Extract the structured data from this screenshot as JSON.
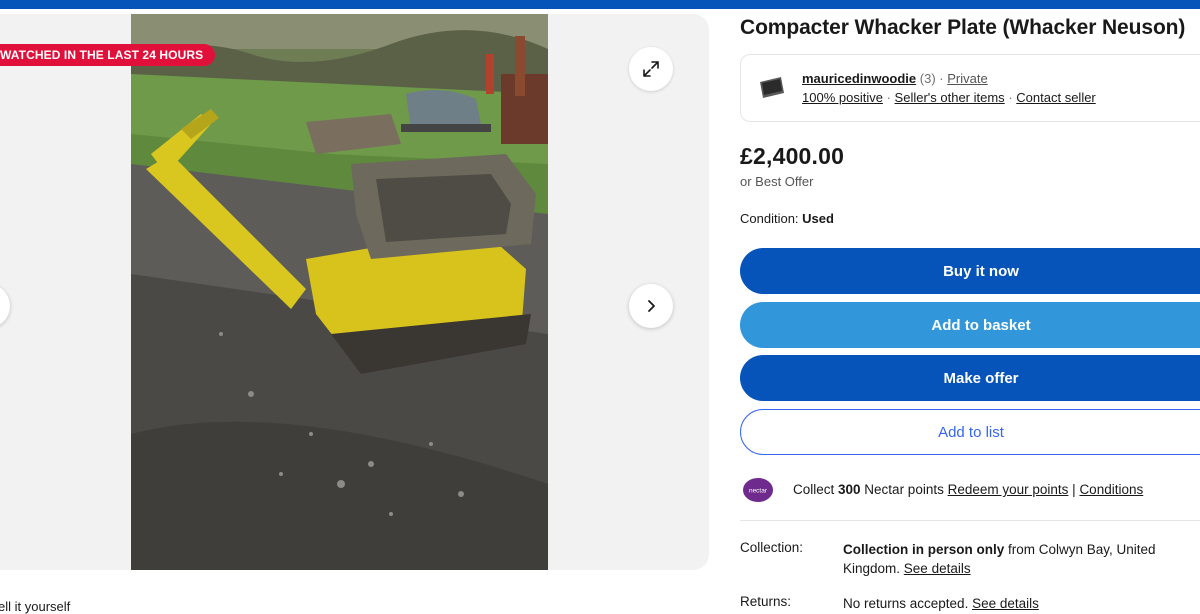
{
  "badge": {
    "watch_text": "WATCHED IN THE LAST 24 HOURS"
  },
  "bottom": {
    "text": "ell it yourself"
  },
  "listing": {
    "title": "Compacter Whacker Plate (Whacker Neuson)"
  },
  "seller": {
    "name": "mauricedinwoodie",
    "feedback_count": "(3)",
    "sep1": "·",
    "type": "Private",
    "positive": "100% positive",
    "sep2": "·",
    "other_items": "Seller's other items",
    "sep3": "·",
    "contact": "Contact seller"
  },
  "price": {
    "amount": "£2,400.00",
    "best_offer": "or Best Offer"
  },
  "condition": {
    "label": "Condition:",
    "value": "Used"
  },
  "buttons": {
    "buy_now": "Buy it now",
    "add_basket": "Add to basket",
    "make_offer": "Make offer",
    "add_list": "Add to list"
  },
  "nectar": {
    "logo": "nectar",
    "prefix": "Collect ",
    "points": "300",
    "suffix": " Nectar points ",
    "redeem": "Redeem your points",
    "pipe": " | ",
    "conditions": "Conditions"
  },
  "collection": {
    "label": "Collection:",
    "bold": "Collection in person only",
    "rest": " from Colwyn Bay, United Kingdom. ",
    "details": "See details"
  },
  "returns": {
    "label": "Returns:",
    "text": "No returns accepted. ",
    "details": "See details"
  },
  "colors": {
    "brand_blue": "#0654ba",
    "basket_blue": "#3197da",
    "link_blue": "#3665f3",
    "badge_red": "#e0103a",
    "nectar_purple": "#6e2a8c"
  },
  "icons": [
    "expand-icon",
    "chevron-left-icon",
    "chevron-right-icon",
    "chevron-down-icon",
    "seller-avatar-icon",
    "nectar-logo-icon"
  ]
}
